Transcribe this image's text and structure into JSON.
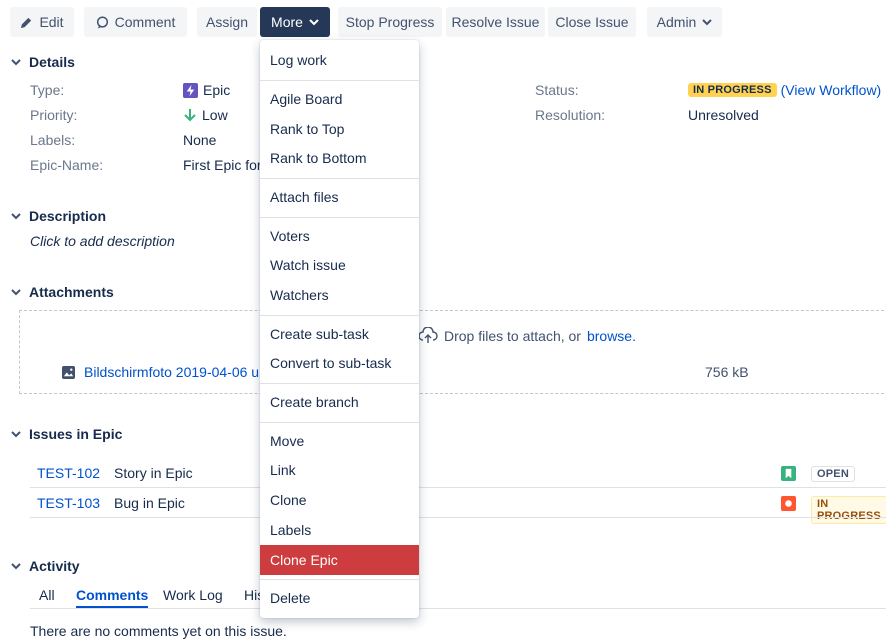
{
  "toolbar": {
    "edit": "Edit",
    "comment": "Comment",
    "assign": "Assign",
    "more": "More",
    "stop_progress": "Stop Progress",
    "resolve_issue": "Resolve Issue",
    "close_issue": "Close Issue",
    "admin": "Admin"
  },
  "details": {
    "heading": "Details",
    "type_label": "Type:",
    "type_value": "Epic",
    "priority_label": "Priority:",
    "priority_value": "Low",
    "labels_label": "Labels:",
    "labels_value": "None",
    "epic_name_label": "Epic-Name:",
    "epic_name_value": "First Epic for",
    "status_label": "Status:",
    "status_value": "IN PROGRESS",
    "view_workflow": "(View Workflow)",
    "resolution_label": "Resolution:",
    "resolution_value": "Unresolved"
  },
  "description": {
    "heading": "Description",
    "placeholder": "Click to add description"
  },
  "attachments": {
    "heading": "Attachments",
    "drop_text": "Drop files to attach, or",
    "browse": "browse.",
    "file_name": "Bildschirmfoto 2019-04-06 u",
    "file_size": "756 kB"
  },
  "issues_in_epic": {
    "heading": "Issues in Epic",
    "rows": [
      {
        "key": "TEST-102",
        "summary": "Story in Epic",
        "status": "OPEN"
      },
      {
        "key": "TEST-103",
        "summary": "Bug in Epic",
        "status": "IN PROGRESS"
      }
    ]
  },
  "activity": {
    "heading": "Activity",
    "tabs": [
      "All",
      "Comments",
      "Work Log",
      "His"
    ],
    "empty": "There are no comments yet on this issue."
  },
  "menu": {
    "items": [
      "Log work",
      "Agile Board",
      "Rank to Top",
      "Rank to Bottom",
      "Attach files",
      "Voters",
      "Watch issue",
      "Watchers",
      "Create sub-task",
      "Convert to sub-task",
      "Create branch",
      "Move",
      "Link",
      "Clone",
      "Labels",
      "Clone Epic",
      "Delete"
    ],
    "highlighted": "Clone Epic"
  },
  "colors": {
    "accent": "#0052cc",
    "more_button": "#253858",
    "menu_highlight": "#cd3d3f",
    "status_yellow": "#ffd351",
    "epic_purple": "#6554c0",
    "story_green": "#36b37e",
    "bug_red": "#ff5630"
  }
}
